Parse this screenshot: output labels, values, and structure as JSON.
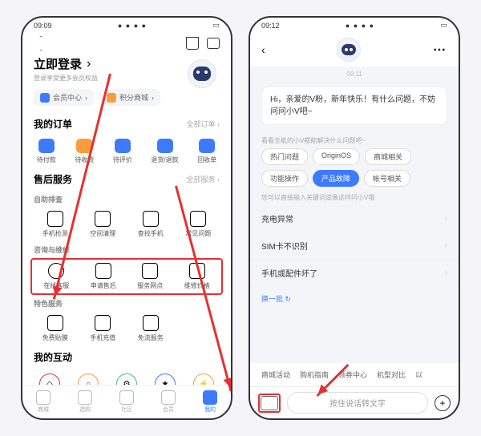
{
  "left": {
    "time": "09:09",
    "status_dots": "● ● ● ●",
    "login_title": "立即登录",
    "login_sub": "登录享受更多会员权益",
    "pills": {
      "member": "会员中心",
      "points": "积分商城"
    },
    "orders_title": "我的订单",
    "orders_more": "全部订单 ›",
    "orders": [
      "待付款",
      "待收货",
      "待评价",
      "退货/退款",
      "回收单"
    ],
    "after_title": "售后服务",
    "after_more": "全部服务 ›",
    "self_sub": "自助排查",
    "self": [
      "手机检测",
      "空间清理",
      "查找手机",
      "常见问题"
    ],
    "consult_sub": "咨询与维修",
    "consult": [
      "在线客服",
      "申请售后",
      "服务网点",
      "维修价格"
    ],
    "feature_sub": "特色服务",
    "feature": [
      "免费贴膜",
      "手机充值",
      "免流服务"
    ],
    "interact_title": "我的互动",
    "tabs": [
      "商城",
      "选购",
      "社区",
      "会员",
      "我的"
    ]
  },
  "right": {
    "time": "09:12",
    "status_dots": "● ● ● ●",
    "timestamp": "09:11",
    "greeting": "Hi，亲爱的V粉，新年快乐！有什么问题，不妨问问小V吧~",
    "hint1": "看看全能的小V都能解决什么问题吧~",
    "chips": [
      "热门问题",
      "OriginOS",
      "商城相关",
      "功能操作",
      "产品故障",
      "帐号相关"
    ],
    "hint2": "您可以直接输入关键词或像这样问小V哦",
    "list": [
      "充电异常",
      "SIM卡不识别",
      "手机或配件坏了"
    ],
    "refresh": "换一批 ↻",
    "bottom_links": [
      "商城活动",
      "购机指南",
      "领券中心",
      "机型对比",
      "以"
    ],
    "input_placeholder": "按住说话转文字"
  }
}
